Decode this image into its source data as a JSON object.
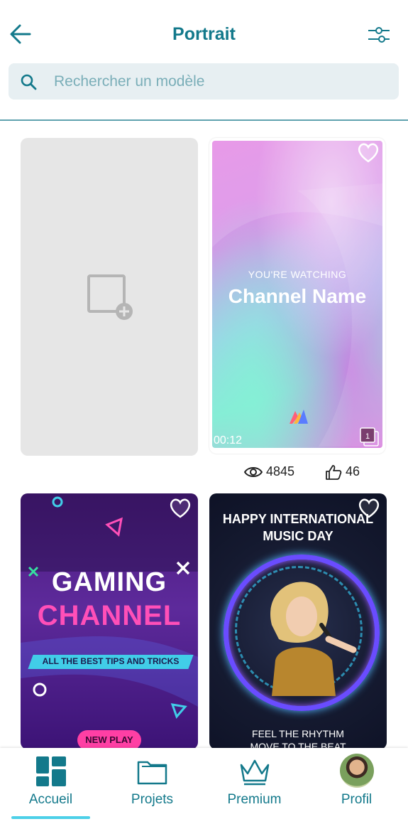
{
  "header": {
    "title": "Portrait",
    "back_icon": "arrow-left-icon",
    "filter_icon": "sliders-icon"
  },
  "search": {
    "placeholder": "Rechercher un modèle",
    "value": ""
  },
  "templates": [
    {
      "kind": "blank",
      "icon": "add-image-icon"
    },
    {
      "kind": "template",
      "overline": "YOU'RE WATCHING",
      "headline": "Channel Name",
      "brand": "CANVELA",
      "duration": "00:12",
      "page_count": "1",
      "views": "4845",
      "likes": "46",
      "favorited": false
    },
    {
      "kind": "template",
      "line1": "GAMING",
      "line2": "CHANNEL",
      "banner": "ALL THE BEST TIPS AND TRICKS",
      "button": "NEW PLAY",
      "favorited": false
    },
    {
      "kind": "template",
      "title": "HAPPY INTERNATIONAL MUSIC DAY",
      "line1": "FEEL THE RHYTHM",
      "line2": "MOVE TO THE BEAT",
      "favorited": false
    }
  ],
  "bottom_nav": [
    {
      "label": "Accueil",
      "icon": "dashboard-icon",
      "active": true
    },
    {
      "label": "Projets",
      "icon": "folder-icon",
      "active": false
    },
    {
      "label": "Premium",
      "icon": "crown-icon",
      "active": false
    },
    {
      "label": "Profil",
      "icon": "avatar",
      "active": false
    }
  ],
  "colors": {
    "accent": "#13798b",
    "indicator": "#4dd0e8",
    "search_bg": "#e7eff2"
  }
}
